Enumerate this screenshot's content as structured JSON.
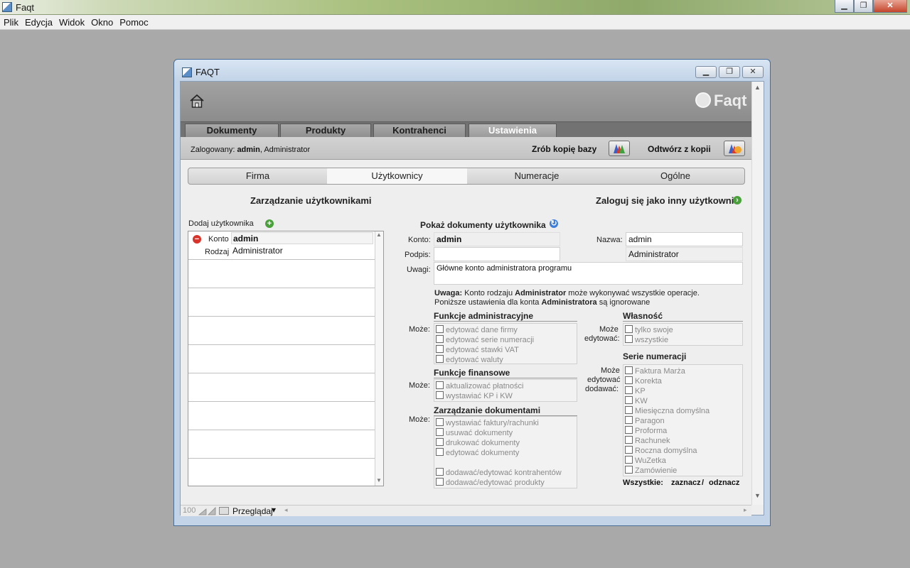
{
  "outer": {
    "title": "Faqt",
    "win_minimize": "▁",
    "win_restore": "❐",
    "win_close": "✕"
  },
  "menu": [
    "Plik",
    "Edycja",
    "Widok",
    "Okno",
    "Pomoc"
  ],
  "inner": {
    "title": "FAQT",
    "logo": "Faqt"
  },
  "tabs": [
    {
      "label": "Dokumenty"
    },
    {
      "label": "Produkty"
    },
    {
      "label": "Kontrahenci"
    },
    {
      "label": "Ustawienia"
    }
  ],
  "info": {
    "logged_prefix": "Zalogowany:",
    "logged_user": "admin",
    "logged_role": ", Administrator",
    "backup_label": "Zrób kopię bazy",
    "restore_label": "Odtwórz z kopii"
  },
  "subtabs": [
    "Firma",
    "Użytkownicy",
    "Numeracje",
    "Ogólne"
  ],
  "users": {
    "heading": "Zarządzanie użytkownikami",
    "login_as": "Zaloguj się jako inny użytkownik",
    "add_user": "Dodaj użytkownika",
    "konto_label": "Konto",
    "konto_value": "admin",
    "rodzaj_label": "Rodzaj",
    "rodzaj_value": "Administrator"
  },
  "form": {
    "show_docs": "Pokaż dokumenty użytkownika",
    "konto_label": "Konto:",
    "konto_value": "admin",
    "nazwa_label": "Nazwa:",
    "nazwa_value": "admin",
    "podpis_label": "Podpis:",
    "podpis_value": "",
    "rodzaj_value": "Administrator",
    "uwagi_label": "Uwagi:",
    "uwagi_value": "Główne konto administratora programu",
    "note_bold1": "Uwaga:",
    "note_text1": " Konto rodzaju ",
    "note_bold2": "Administrator",
    "note_text2": " może wykonywać wszystkie operacje.",
    "note_line2a": "Poniższe ustawienia dla konta ",
    "note_bold3": "Administratora",
    "note_line2b": " są ignorowane"
  },
  "groups": {
    "admin": {
      "title": "Funkcje administracyjne",
      "label": "Może:",
      "items": [
        "edytować dane firmy",
        "edytować serie numeracji",
        "edytować stawki VAT",
        "edytować waluty"
      ]
    },
    "finance": {
      "title": "Funkcje finansowe",
      "label": "Może:",
      "items": [
        "aktualizować płatności",
        "wystawiać KP i KW"
      ]
    },
    "docs": {
      "title": "Zarządzanie dokumentami",
      "label": "Może:",
      "items": [
        "wystawiać faktury/rachunki",
        "usuwać dokumenty",
        "drukować dokumenty",
        "edytować dokumenty",
        "dodawać/edytować kontrahentów",
        "dodawać/edytować produkty"
      ]
    },
    "owner": {
      "title": "Własność",
      "label1": "Może",
      "label2": "edytować:",
      "items": [
        "tylko swoje",
        "wszystkie"
      ]
    },
    "series": {
      "title": "Serie numeracji",
      "label1": "Może",
      "label2": "edytować",
      "label3": "dodawać:",
      "items": [
        "Faktura Marża",
        "Korekta",
        "KP",
        "KW",
        "Miesięczna domyślna",
        "Paragon",
        "Proforma",
        "Rachunek",
        "Roczna domyślna",
        "WuZetka",
        "Zamówienie"
      ]
    },
    "all_label": "Wszystkie:",
    "select_all": "zaznacz",
    "sep": "/",
    "deselect_all": "odznacz"
  },
  "statusbar": {
    "zoom": "100",
    "view": "Przeglądaj"
  },
  "colors": {
    "banner": "#8c8c8c",
    "tabbar": "#727272",
    "active_tab_text": "#ffffff",
    "add_green": "#4aa03a",
    "remove_red": "#d9342b",
    "refresh_blue": "#3d7fd8"
  }
}
